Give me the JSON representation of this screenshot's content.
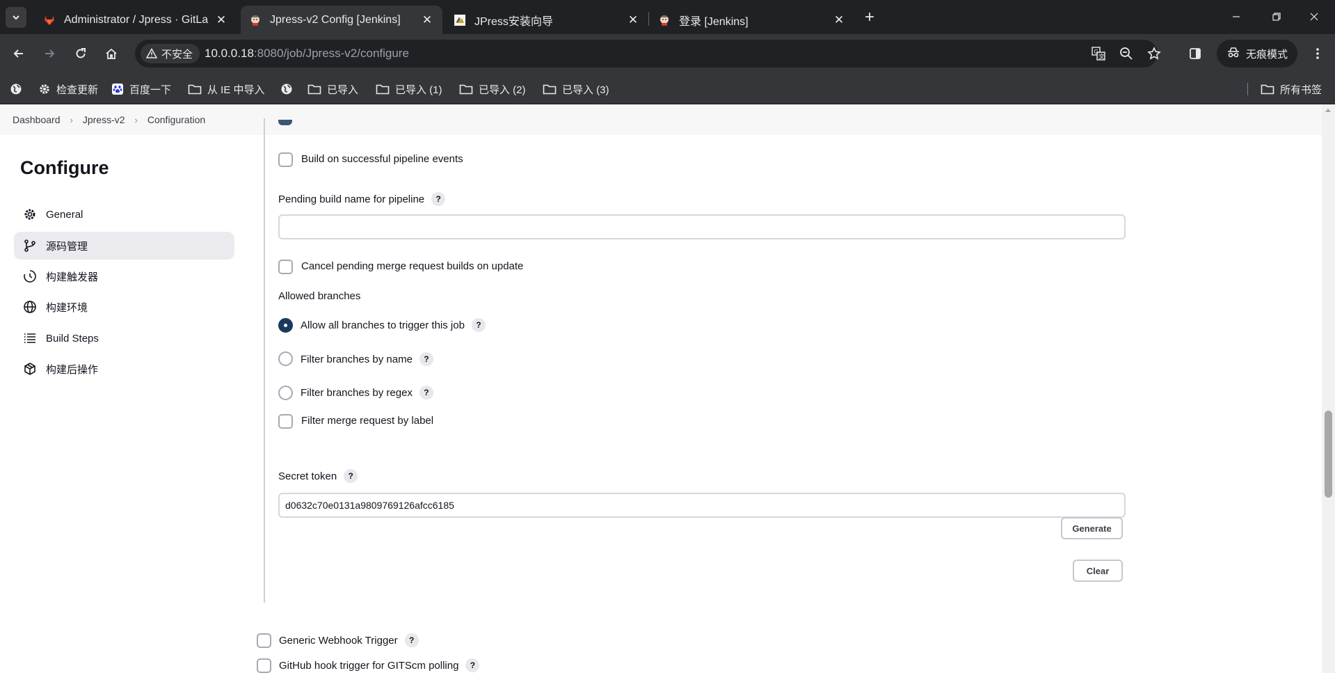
{
  "browser": {
    "tabs": [
      {
        "title": "Administrator / Jpress · GitLab",
        "icon": "gitlab-icon",
        "active": false
      },
      {
        "title": "Jpress-v2 Config [Jenkins]",
        "icon": "jenkins-icon",
        "active": true
      },
      {
        "title": "JPress安装向导",
        "icon": "jpress-icon",
        "active": false
      },
      {
        "title": "登录 [Jenkins]",
        "icon": "jenkins-icon",
        "active": false
      }
    ],
    "address": {
      "security_label": "不安全",
      "host": "10.0.0.18",
      "path": ":8080/job/Jpress-v2/configure"
    },
    "incognito_label": "无痕模式",
    "bookmarks": [
      {
        "label": "",
        "icon": "globe-icon"
      },
      {
        "label": "检查更新",
        "icon": "gear-icon"
      },
      {
        "label": "百度一下",
        "icon": "baidu-icon"
      },
      {
        "label": "从 IE 中导入",
        "icon": "folder-icon"
      },
      {
        "label": "",
        "icon": "globe-icon"
      },
      {
        "label": "已导入",
        "icon": "folder-icon"
      },
      {
        "label": "已导入 (1)",
        "icon": "folder-icon"
      },
      {
        "label": "已导入 (2)",
        "icon": "folder-icon"
      },
      {
        "label": "已导入 (3)",
        "icon": "folder-icon"
      }
    ],
    "all_bookmarks_label": "所有书签"
  },
  "breadcrumb": [
    "Dashboard",
    "Jpress-v2",
    "Configuration"
  ],
  "sidebar": {
    "title": "Configure",
    "items": [
      {
        "label": "General",
        "icon": "gear-icon",
        "active": false
      },
      {
        "label": "源码管理",
        "icon": "branch-icon",
        "active": true
      },
      {
        "label": "构建触发器",
        "icon": "clock-icon",
        "active": false
      },
      {
        "label": "构建环境",
        "icon": "globe-icon",
        "active": false
      },
      {
        "label": "Build Steps",
        "icon": "list-icon",
        "active": false
      },
      {
        "label": "构建后操作",
        "icon": "package-icon",
        "active": false
      }
    ]
  },
  "form": {
    "build_on_pipeline_events": {
      "label": "Build on successful pipeline events",
      "checked": false
    },
    "pending_build_name": {
      "label": "Pending build name for pipeline",
      "value": ""
    },
    "cancel_pending": {
      "label": "Cancel pending merge request builds on update",
      "checked": false
    },
    "allowed_branches": {
      "label": "Allowed branches",
      "options": [
        {
          "label": "Allow all branches to trigger this job",
          "checked": true
        },
        {
          "label": "Filter branches by name",
          "checked": false
        },
        {
          "label": "Filter branches by regex",
          "checked": false
        }
      ]
    },
    "filter_by_label": {
      "label": "Filter merge request by label",
      "checked": false
    },
    "secret_token": {
      "label": "Secret token",
      "value": "d0632c70e0131a9809769126afcc6185"
    },
    "generate_label": "Generate",
    "clear_label": "Clear",
    "generic_webhook": {
      "label": "Generic Webhook Trigger",
      "checked": false
    },
    "github_hook": {
      "label": "GitHub hook trigger for GITScm polling",
      "checked": false
    }
  },
  "help_glyph": "?"
}
